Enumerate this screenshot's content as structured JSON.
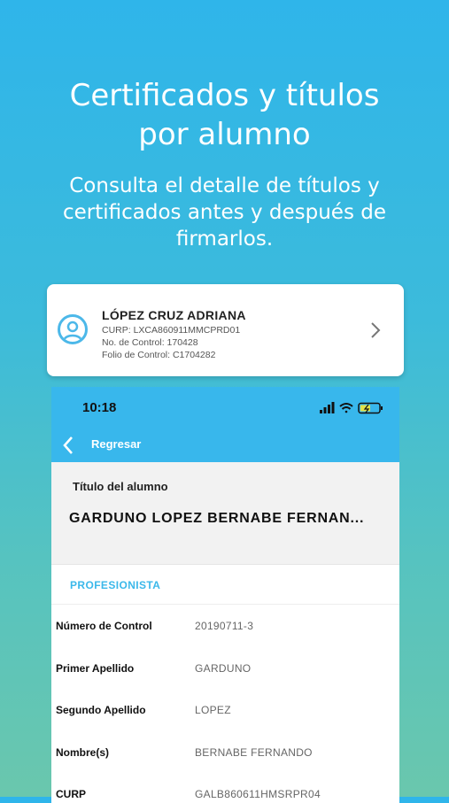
{
  "headline": [
    "Certificados y títulos",
    "por alumno"
  ],
  "subline": [
    "Consulta el detalle de títulos y",
    "certificados antes y después de",
    "firmarlos."
  ],
  "card": {
    "name": "LÓPEZ CRUZ ADRIANA",
    "curp": "CURP: LXCA860911MMCPRD01",
    "control": "No. de Control: 170428",
    "folio": "Folio de Control: C1704282"
  },
  "phone": {
    "time": "10:18",
    "back_label": "Regresar",
    "title_label": "Título del alumno",
    "title_name": "GARDUNO LOPEZ BERNABE FERNAN...",
    "section": "PROFESIONISTA",
    "rows": [
      {
        "label": "Número de Control",
        "value": "20190711-3"
      },
      {
        "label": "Primer Apellido",
        "value": "GARDUNO"
      },
      {
        "label": "Segundo Apellido",
        "value": "LOPEZ"
      },
      {
        "label": "Nombre(s)",
        "value": "BERNABE FERNANDO"
      },
      {
        "label": "CURP",
        "value": "GALB860611HMSRPR04"
      }
    ]
  },
  "colors": {
    "accent": "#38b7ec",
    "gradient_top": "#2fb5ea",
    "gradient_bottom": "#6ac7ad"
  },
  "icons": [
    "user-avatar-icon",
    "chevron-right-icon",
    "chevron-left-icon",
    "signal-icon",
    "wifi-icon",
    "battery-icon"
  ]
}
